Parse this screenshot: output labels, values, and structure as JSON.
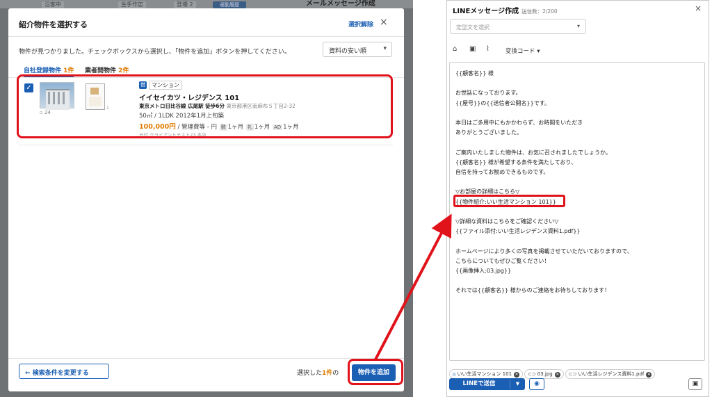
{
  "colors": {
    "accent": "#1a5fb4",
    "highlight": "#e0121a",
    "count": "#e07b00"
  },
  "background_app": {
    "chips": [
      "沿客中",
      "生手作店",
      "登場 2"
    ],
    "blue_button": "運動履歴",
    "header_title": "メールメッセージ作成"
  },
  "modal": {
    "title": "紹介物件を選択する",
    "clear_label": "選択解除",
    "close_icon": "×",
    "description": "物件が見つかりました。チェックボックスから選択し、「物件を追加」ボタンを押してください。",
    "sort": {
      "selected": "資料の安い順"
    },
    "tabs": [
      {
        "label": "自社登録物件",
        "count": "1件"
      },
      {
        "label": "業者間物件",
        "count": "2件"
      }
    ],
    "property": {
      "checked": true,
      "photo_count": "24",
      "floorplan_index": "1",
      "badge": "借",
      "type": "マンション",
      "name": "イイセイカツ・レジデンス 101",
      "access": "東京メトロ日比谷線 広尾駅 徒歩6分",
      "address": "東京都港区南麻布５丁目2-32",
      "spec": "50㎡ / 1LDK  2012年1月上旬築",
      "price": "100,000円",
      "price_suffix": " / 管理費等 - 円",
      "deposit_tag": "敷",
      "deposit": "1ヶ月",
      "key_money_tag": "礼",
      "key_money": "1ヶ月",
      "ad_tag": "AD",
      "ad": "1ヶ月",
      "source": "元付 クライアントテスト23 本店"
    },
    "back_button": "検索条件を変更する",
    "selected_prefix": "選択した",
    "selected_count": "1件",
    "selected_suffix": "の",
    "add_button": "物件を追加"
  },
  "line_panel": {
    "title": "LINEメッセージ作成",
    "char_count": "送信数：2/200",
    "close_icon": "×",
    "template_placeholder": "定型文を選択",
    "convert_label": "変換コード ▾",
    "message_lines": [
      "{{顧客名}} 様",
      "",
      "お世話になっております。",
      "{{屋号}}の{{送信者公開名}}です。",
      "",
      "本日はご多用中にもかかわらず、お時間をいただき",
      "ありがとうございました。",
      "",
      "ご案内いたしました物件は、お気に召されましたでしょうか。",
      "{{顧客名}} 様が希望する条件を満たしており、",
      "自信を持ってお勧めできるものです。",
      "",
      "▽お部屋の詳細はこちら▽",
      "{{物件紹介:いい生活マンション 101}}",
      "",
      "▽詳細な資料はこちらをご確認ください▽",
      "{{ファイル添付:いい生活レジデンス資料1.pdf}}",
      "",
      "ホームページにより多くの写真を掲載させていただいておりますので、",
      "こちらについてもぜひご覧ください！",
      "{{画像挿入:03.jpg}}",
      "",
      "それでは{{顧客名}} 様からのご連絡をお待ちしております！"
    ],
    "attachments": [
      {
        "icon": "building-icon",
        "label": "いい生活マンション 101"
      },
      {
        "icon": "link-icon",
        "label": "03.jpg"
      },
      {
        "icon": "link-icon",
        "label": "いい生活レジデンス資料1.pdf"
      }
    ],
    "send_button": "LINEで送信"
  }
}
